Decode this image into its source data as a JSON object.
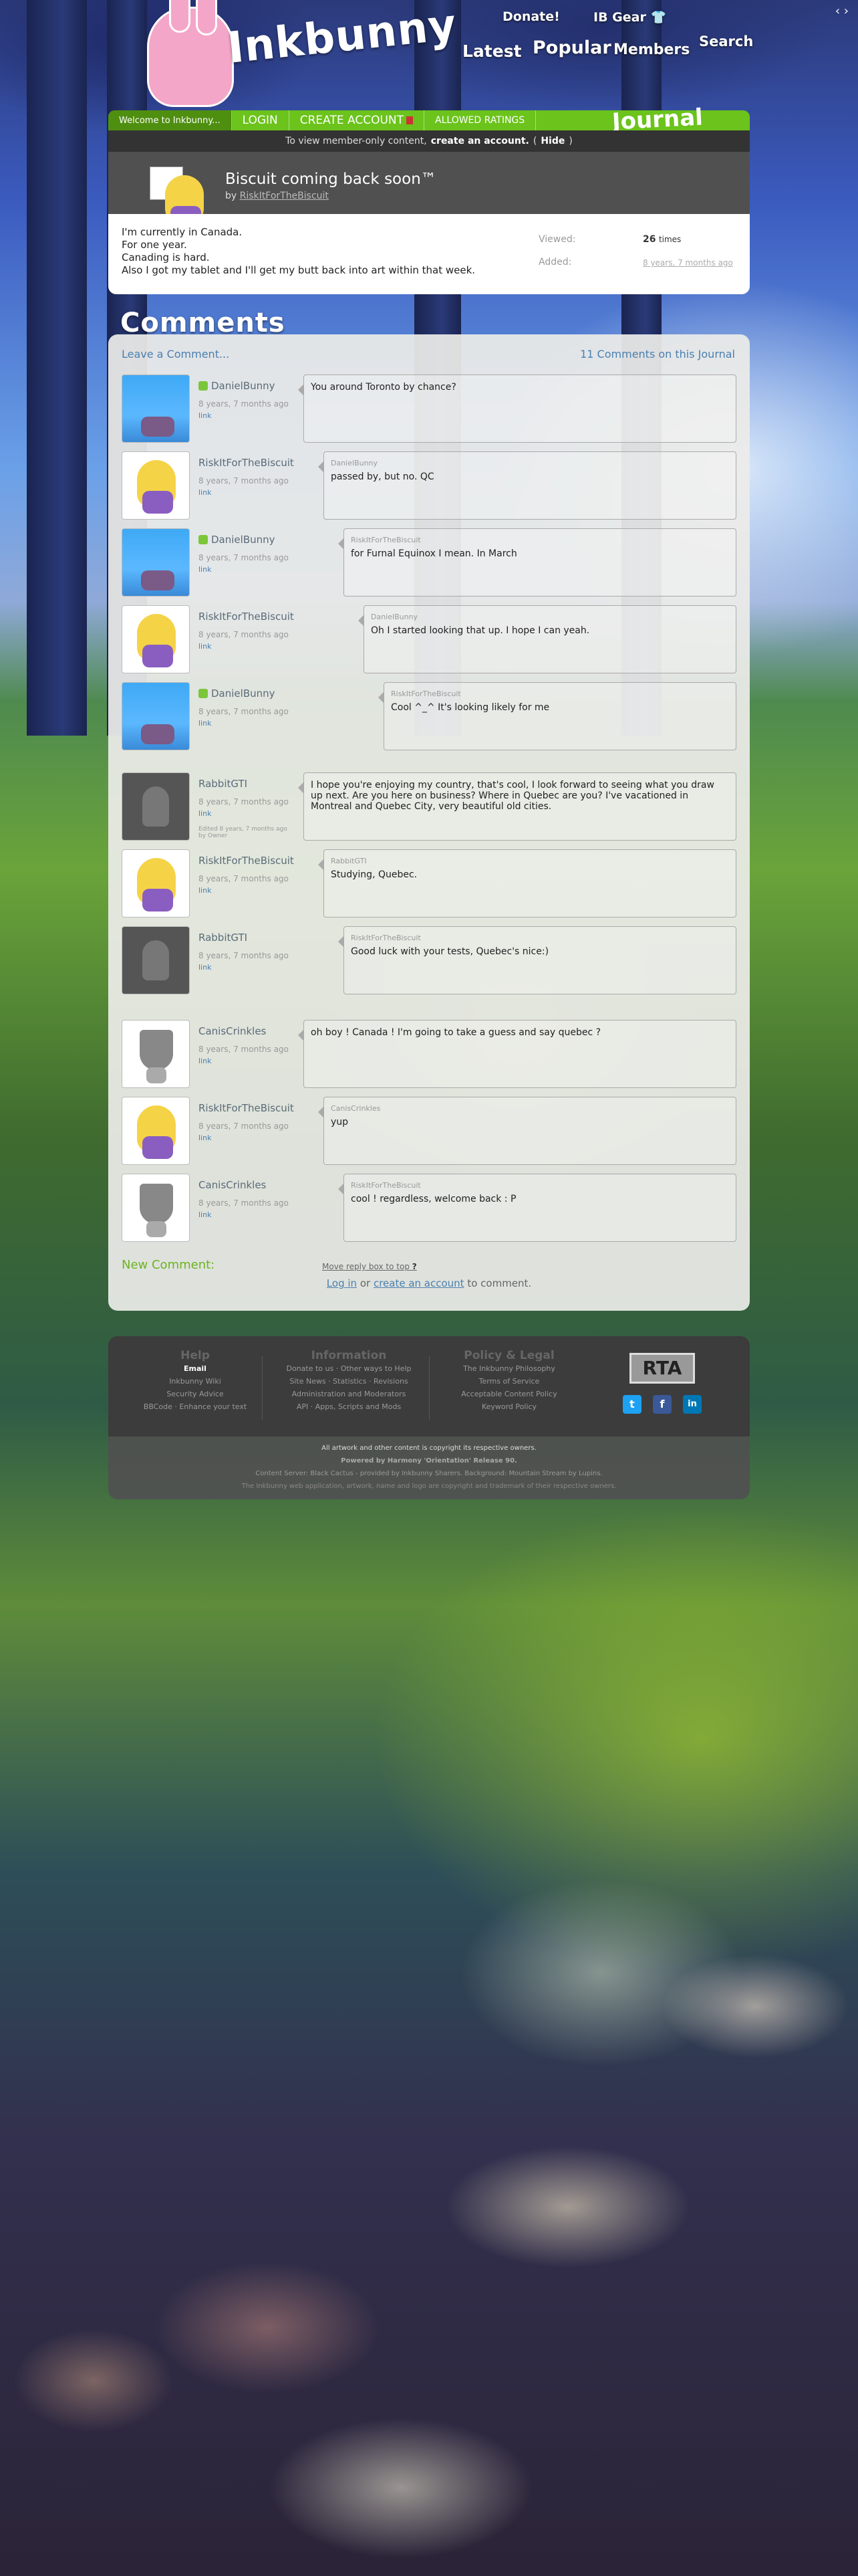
{
  "header": {
    "logo": "Inkbunny",
    "nav": {
      "donate": "Donate!",
      "gear": "IB Gear",
      "latest": "Latest",
      "popular": "Popular",
      "members": "Members",
      "search": "Search"
    },
    "arrows": "‹  ›"
  },
  "topbar": {
    "welcome": "Welcome to Inkbunny...",
    "login": "LOGIN",
    "create": "CREATE ACCOUNT",
    "ratings": "ALLOWED RATINGS",
    "section": "Journal"
  },
  "memberbar": {
    "pre": "To view member-only content,",
    "link": "create an account.",
    "hide_open": "(",
    "hide": "Hide",
    "hide_close": ")"
  },
  "journal": {
    "title": "Biscuit coming back soon™",
    "by": "by",
    "author": "RiskItForTheBiscuit",
    "body": [
      "I'm currently in Canada.",
      "For one year.",
      "Canading is hard.",
      "Also I got my tablet and I'll get my butt back into art within that week."
    ],
    "viewed_label": "Viewed:",
    "viewed_value": "26",
    "viewed_unit": "times",
    "added_label": "Added:",
    "added_value": "8 years, 7 months ago"
  },
  "comments": {
    "heading": "Comments",
    "leave": "Leave a Comment...",
    "count": "11 Comments on this Journal",
    "items": [
      {
        "user": "DanielBunny",
        "time": "8 years, 7 months ago",
        "link": "link",
        "reply_to": "",
        "text": "You around Toronto by chance?",
        "edited": ""
      },
      {
        "user": "RiskItForTheBiscuit",
        "time": "8 years, 7 months ago",
        "link": "link",
        "reply_to": "DanielBunny",
        "text": "passed by, but no. QC",
        "edited": ""
      },
      {
        "user": "DanielBunny",
        "time": "8 years, 7 months ago",
        "link": "link",
        "reply_to": "RiskItForTheBiscuit",
        "text": "for Furnal Equinox I mean. In March",
        "edited": ""
      },
      {
        "user": "RiskItForTheBiscuit",
        "time": "8 years, 7 months ago",
        "link": "link",
        "reply_to": "DanielBunny",
        "text": "Oh I started looking that up. I hope I can yeah.",
        "edited": ""
      },
      {
        "user": "DanielBunny",
        "time": "8 years, 7 months ago",
        "link": "link",
        "reply_to": "RiskItForTheBiscuit",
        "text": "Cool ^_^ It's looking likely for me",
        "edited": ""
      },
      {
        "user": "RabbitGTI",
        "time": "8 years, 7 months ago",
        "link": "link",
        "reply_to": "",
        "text": "I hope you're enjoying my country, that's cool, I look forward to seeing what you draw up next. Are you here on business? Where in Quebec are you? I've vacationed in Montreal and Quebec City, very beautiful old cities.",
        "edited": "Edited 8 years, 7 months ago by Owner"
      },
      {
        "user": "RiskItForTheBiscuit",
        "time": "8 years, 7 months ago",
        "link": "link",
        "reply_to": "RabbitGTI",
        "text": "Studying, Quebec.",
        "edited": ""
      },
      {
        "user": "RabbitGTI",
        "time": "8 years, 7 months ago",
        "link": "link",
        "reply_to": "RiskItForTheBiscuit",
        "text": "Good luck with your tests, Quebec's nice:)",
        "edited": ""
      },
      {
        "user": "CanisCrinkles",
        "time": "8 years, 7 months ago",
        "link": "link",
        "reply_to": "",
        "text": "oh boy ! Canada ! I'm going to take a guess and say quebec ?",
        "edited": ""
      },
      {
        "user": "RiskItForTheBiscuit",
        "time": "8 years, 7 months ago",
        "link": "link",
        "reply_to": "CanisCrinkles",
        "text": "yup",
        "edited": ""
      },
      {
        "user": "CanisCrinkles",
        "time": "8 years, 7 months ago",
        "link": "link",
        "reply_to": "RiskItForTheBiscuit",
        "text": "cool ! regardless, welcome back : P",
        "edited": ""
      }
    ],
    "new_comment": "New Comment:",
    "move": "Move reply box to top",
    "move_q": "?",
    "login": "Log in",
    "or": "or",
    "create": "create an account",
    "to_comment": "to comment."
  },
  "footer": {
    "help": {
      "title": "Help",
      "items": [
        "Email",
        "Inkbunny Wiki",
        "Security Advice",
        "BBCode · Enhance your text"
      ]
    },
    "info": {
      "title": "Information",
      "items": [
        "Donate to us · Other ways to Help",
        "Site News · Statistics · Revisions",
        "Administration and Moderators",
        "API · Apps, Scripts and Mods"
      ]
    },
    "policy": {
      "title": "Policy & Legal",
      "items": [
        "The Inkbunny Philosophy",
        "Terms of Service",
        "Acceptable Content Policy",
        "Keyword Policy"
      ]
    },
    "rta": "RTA",
    "social": [
      "t",
      "f",
      "in"
    ],
    "line1": "All artwork and other content is copyright its respective owners.",
    "line2": "Powered by Harmony 'Orientation' Release 90.",
    "line3": "Content Server: Black Cactus - provided by Inkbunny Sharers. Background: Mountain Stream by Lupins.",
    "line4": "The Inkbunny web application, artwork, name and logo are copyright and trademark of their respective owners."
  },
  "colors": {
    "accent": "#6bc31b",
    "link": "#4a7fb0",
    "dark": "#3c3c3c"
  }
}
